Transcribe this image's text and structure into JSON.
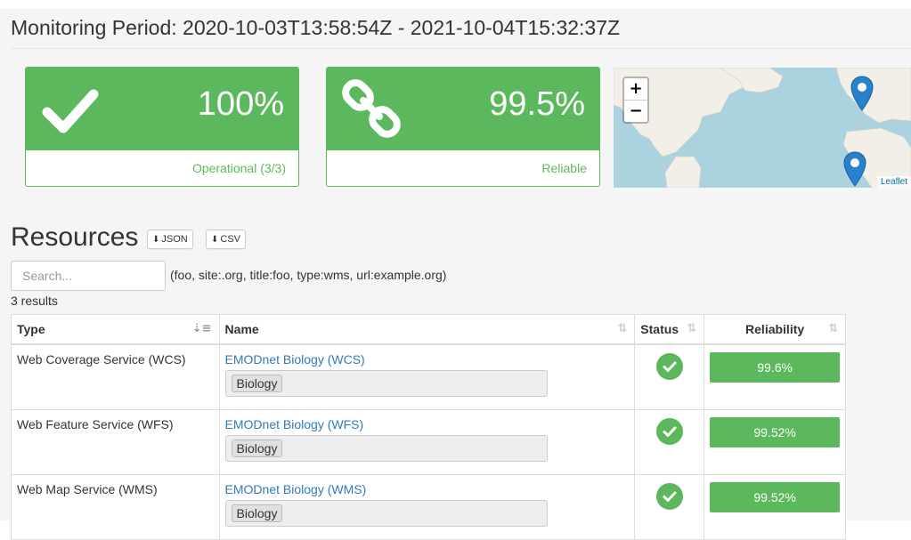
{
  "monitoring": {
    "label": "Monitoring Period:",
    "range": "2020-10-03T13:58:54Z - 2021-10-04T15:32:37Z"
  },
  "panels": [
    {
      "icon": "check-icon",
      "value": "100%",
      "caption": "Operational (3/3)",
      "color": "#5cb85c"
    },
    {
      "icon": "link-icon",
      "value": "99.5%",
      "caption": "Reliable",
      "color": "#5cb85c"
    }
  ],
  "map": {
    "zoom_in": "+",
    "zoom_out": "−",
    "attribution": "Leaflet",
    "markers": [
      "map-marker-icon",
      "map-marker-icon"
    ]
  },
  "resources": {
    "title": "Resources",
    "json_label": "JSON",
    "csv_label": "CSV",
    "search_placeholder": "Search...",
    "search_value": "",
    "search_hint": "(foo, site:.org, title:foo, type:wms, url:example.org)",
    "results_count": "3 results",
    "columns": [
      "Type",
      "Name",
      "Status",
      "Reliability"
    ],
    "rows": [
      {
        "type": "Web Coverage Service (WCS)",
        "name": "EMODnet Biology (WCS)",
        "tag": "Biology",
        "status": "ok",
        "reliability": "99.6%",
        "reliability_value": 99.6
      },
      {
        "type": "Web Feature Service (WFS)",
        "name": "EMODnet Biology (WFS)",
        "tag": "Biology",
        "status": "ok",
        "reliability": "99.52%",
        "reliability_value": 99.52
      },
      {
        "type": "Web Map Service (WMS)",
        "name": "EMODnet Biology (WMS)",
        "tag": "Biology",
        "status": "ok",
        "reliability": "99.52%",
        "reliability_value": 99.52
      }
    ]
  },
  "colors": {
    "success": "#5cb85c",
    "link": "#337ab7",
    "map_water": "#aad3df"
  }
}
